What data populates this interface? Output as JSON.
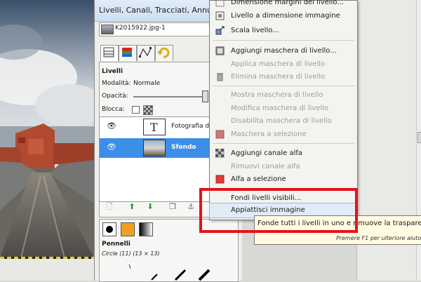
{
  "window": {
    "title": "Livelli, Canali, Tracciati, Annulla - P"
  },
  "image_selector": {
    "value": "K2015922.jpg-1"
  },
  "tabs": [
    {
      "icon": "layers-icon"
    },
    {
      "icon": "channels-icon"
    },
    {
      "icon": "paths-icon"
    },
    {
      "icon": "undo-icon"
    }
  ],
  "layers_panel": {
    "title": "Livelli",
    "mode_label": "Modalità:",
    "mode_value": "Normale",
    "opacity_label": "Opacità:",
    "lock_label": "Blocca:",
    "layers": [
      {
        "name": "Fotografia di",
        "type": "text",
        "visible": true,
        "selected": false
      },
      {
        "name": "Sfondo",
        "type": "image",
        "visible": true,
        "selected": true
      }
    ]
  },
  "brushes_panel": {
    "title": "Pennelli",
    "subtitle": "Circle (11) (13 × 13)"
  },
  "context_menu": {
    "items": [
      {
        "label": "Dimensione margini del livello...",
        "icon": "resize-border-icon",
        "enabled": true
      },
      {
        "label": "Livello a dimensione immagine",
        "icon": "layer-to-image-size-icon",
        "enabled": true
      },
      {
        "label": "Scala livello...",
        "icon": "scale-layer-icon",
        "enabled": true
      },
      {
        "label": "Aggiungi maschera di livello...",
        "icon": "add-mask-icon",
        "enabled": true
      },
      {
        "label": "Applica maschera di livello",
        "icon": "",
        "enabled": false
      },
      {
        "label": "Elimina maschera di livello",
        "icon": "trash-icon",
        "enabled": false
      },
      {
        "label": "Mostra maschera di livello",
        "icon": "",
        "enabled": false
      },
      {
        "label": "Modifica maschera di livello",
        "icon": "",
        "enabled": false
      },
      {
        "label": "Disabilita maschera di livello",
        "icon": "",
        "enabled": false
      },
      {
        "label": "Maschera a selezione",
        "icon": "mask-to-selection-icon",
        "enabled": false
      },
      {
        "label": "Aggiungi canale alfa",
        "icon": "alpha-icon",
        "enabled": true
      },
      {
        "label": "Rimuovi canale alfa",
        "icon": "",
        "enabled": false
      },
      {
        "label": "Alfa a selezione",
        "icon": "alpha-to-selection-icon",
        "enabled": true
      },
      {
        "label": "Fondi livelli visibili...",
        "icon": "",
        "enabled": true
      },
      {
        "label": "Appiattisci immagine",
        "icon": "",
        "enabled": true,
        "highlighted": true
      }
    ]
  },
  "tooltip": {
    "text": "Fonde tutti i livelli in uno e rimuove la trasparenza",
    "hint": "Premere F1 per ulteriore aiuto"
  },
  "colors": {
    "selection_blue": "#3d8ee8",
    "highlight_red": "#e8101a",
    "tooltip_bg": "#fffbe3"
  }
}
